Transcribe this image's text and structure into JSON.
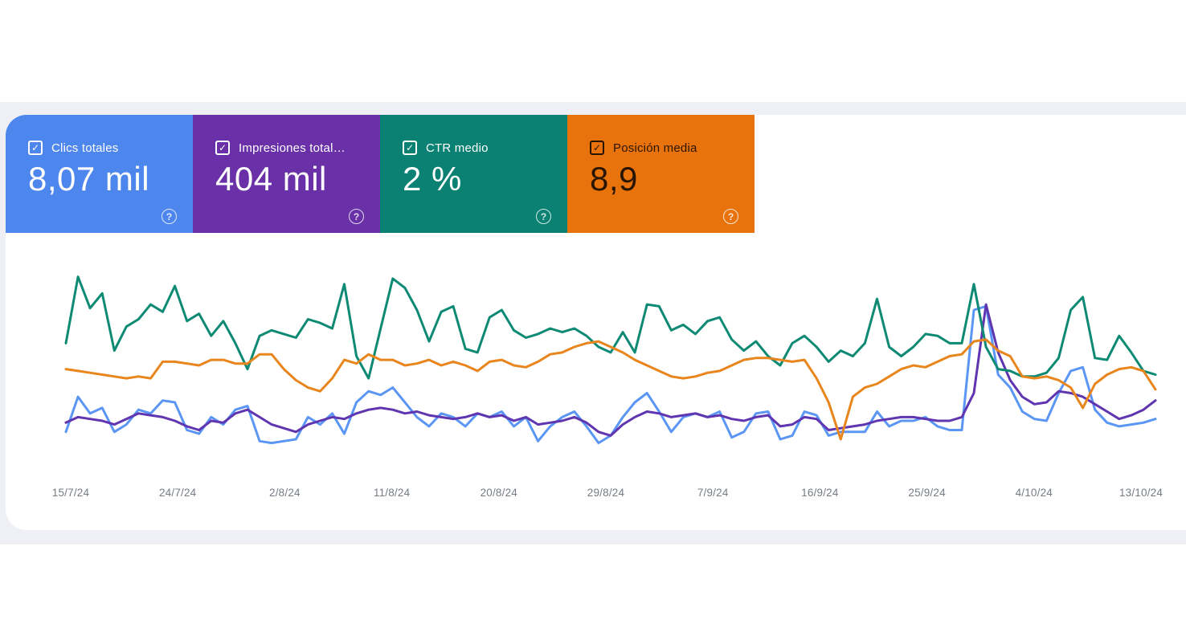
{
  "icons": {
    "check": "✓",
    "help": "?"
  },
  "page": {
    "background": "#ffffff",
    "band_color": "#eef0f6",
    "panel_color": "#ffffff"
  },
  "cards": [
    {
      "id": "clicks",
      "label": "Clics totales",
      "value": "8,07 mil",
      "bg": "#4d86ec",
      "text_color": "#ffffff",
      "checked": true
    },
    {
      "id": "impressions",
      "label": "Impresiones total…",
      "value": "404 mil",
      "bg": "#6930a8",
      "text_color": "#ffffff",
      "checked": true
    },
    {
      "id": "ctr",
      "label": "CTR medio",
      "value": "2 %",
      "bg": "#0a8173",
      "text_color": "#ffffff",
      "checked": true
    },
    {
      "id": "position",
      "label": "Posición media",
      "value": "8,9",
      "bg": "#e8730c",
      "text_color": "rgba(0,0,0,0.82)",
      "checked": true
    }
  ],
  "chart_data": {
    "type": "line",
    "title": "Rendimiento en la Búsqueda (Search Console)",
    "x_axis": {
      "tick_labels": [
        "15/7/24",
        "24/7/24",
        "2/8/24",
        "11/8/24",
        "20/8/24",
        "29/8/24",
        "7/9/24",
        "16/9/24",
        "25/9/24",
        "4/10/24",
        "13/10/24"
      ],
      "start_date": "15/7/24",
      "end_date": "13/10/24",
      "points_per_series": 91
    },
    "y_axis": "hidden — each series independently auto-scaled; values below are normalized 0-100 of plot height",
    "totals": {
      "clicks": "8,07 mil",
      "impressions": "404 mil",
      "ctr": "2 %",
      "position": "8,9"
    },
    "grid": false,
    "legend_position": "none (metric cards act as legend)",
    "series": [
      {
        "id": "clicks",
        "name": "Clics",
        "color": "#5b96f5",
        "values": [
          14,
          33,
          24,
          27,
          14,
          18,
          26,
          24,
          31,
          30,
          15,
          13,
          22,
          18,
          26,
          28,
          9,
          8,
          9,
          10,
          22,
          18,
          24,
          13,
          30,
          36,
          34,
          38,
          30,
          22,
          17,
          24,
          22,
          17,
          24,
          22,
          25,
          17,
          22,
          9,
          17,
          22,
          25,
          17,
          8,
          12,
          22,
          30,
          35,
          25,
          14,
          22,
          24,
          22,
          25,
          11,
          14,
          24,
          25,
          10,
          12,
          25,
          23,
          12,
          14,
          14,
          14,
          25,
          17,
          20,
          20,
          22,
          17,
          15,
          15,
          80,
          82,
          45,
          38,
          25,
          21,
          20,
          35,
          47,
          49,
          26,
          19,
          17,
          18,
          19,
          21
        ]
      },
      {
        "id": "impressions",
        "name": "Impresiones",
        "color": "#5f35b0",
        "values": [
          19,
          22,
          21,
          20,
          18,
          21,
          24,
          23,
          22,
          20,
          17,
          15,
          20,
          19,
          24,
          26,
          22,
          18,
          16,
          14,
          18,
          20,
          22,
          21,
          24,
          26,
          27,
          26,
          24,
          25,
          23,
          22,
          21,
          22,
          24,
          22,
          23,
          20,
          22,
          18,
          19,
          20,
          22,
          19,
          14,
          12,
          18,
          22,
          25,
          24,
          22,
          23,
          24,
          22,
          23,
          21,
          20,
          22,
          23,
          17,
          18,
          22,
          21,
          15,
          16,
          17,
          18,
          20,
          21,
          22,
          22,
          21,
          20,
          20,
          22,
          35,
          83,
          57,
          42,
          33,
          29,
          30,
          36,
          35,
          33,
          29,
          25,
          21,
          23,
          26,
          31
        ]
      },
      {
        "id": "ctr",
        "name": "CTR",
        "color": "#0e8a74",
        "values": [
          62,
          98,
          81,
          89,
          58,
          71,
          75,
          83,
          79,
          93,
          74,
          78,
          66,
          74,
          62,
          48,
          66,
          69,
          67,
          65,
          75,
          73,
          70,
          94,
          55,
          43,
          70,
          97,
          92,
          80,
          63,
          79,
          82,
          59,
          57,
          76,
          80,
          69,
          65,
          67,
          70,
          68,
          70,
          66,
          60,
          57,
          68,
          57,
          83,
          82,
          69,
          72,
          67,
          74,
          76,
          64,
          58,
          63,
          55,
          50,
          62,
          66,
          60,
          52,
          58,
          55,
          62,
          86,
          60,
          55,
          60,
          67,
          66,
          62,
          62,
          94,
          60,
          48,
          47,
          44,
          44,
          46,
          54,
          80,
          87,
          54,
          53,
          66,
          57,
          47,
          45
        ]
      },
      {
        "id": "position",
        "name": "Posición",
        "color": "#e8851c",
        "values": [
          48,
          47,
          46,
          45,
          44,
          43,
          44,
          43,
          52,
          52,
          51,
          50,
          53,
          53,
          51,
          51,
          56,
          56,
          48,
          42,
          38,
          36,
          43,
          53,
          51,
          56,
          53,
          53,
          50,
          51,
          53,
          50,
          52,
          50,
          47,
          52,
          53,
          50,
          49,
          52,
          56,
          57,
          60,
          62,
          63,
          60,
          57,
          53,
          50,
          47,
          44,
          43,
          44,
          46,
          47,
          50,
          53,
          54,
          54,
          53,
          52,
          53,
          43,
          30,
          10,
          33,
          38,
          40,
          44,
          48,
          50,
          49,
          52,
          55,
          56,
          63,
          64,
          58,
          55,
          44,
          43,
          44,
          42,
          38,
          27,
          40,
          45,
          48,
          49,
          47,
          37
        ]
      }
    ]
  }
}
